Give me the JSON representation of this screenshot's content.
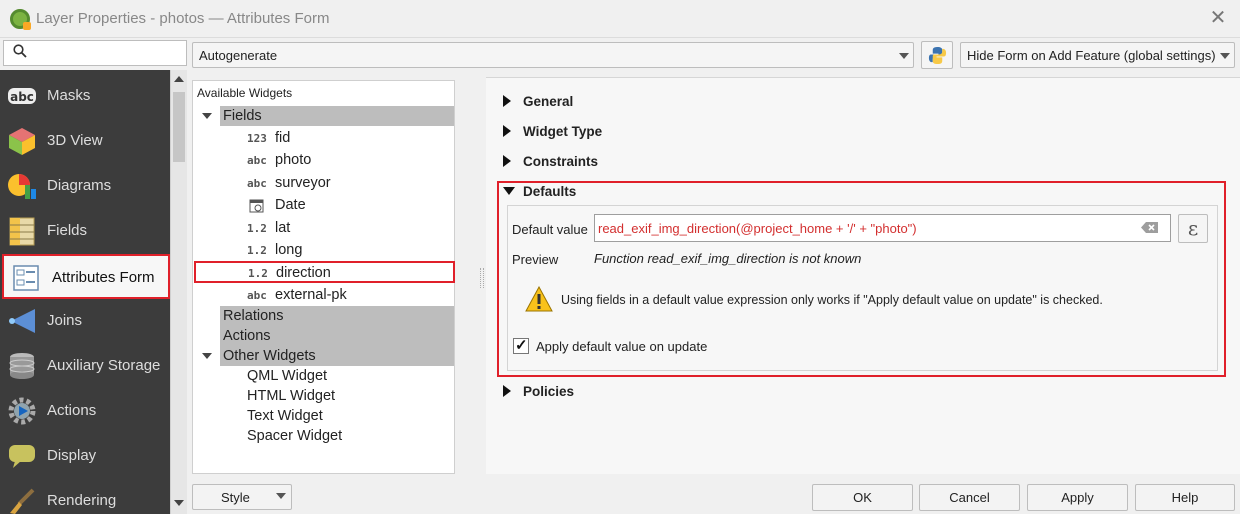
{
  "window": {
    "title": "Layer Properties - photos — Attributes Form"
  },
  "sidebar": {
    "items": [
      {
        "label": "Masks",
        "icon": "masks-icon"
      },
      {
        "label": "3D View",
        "icon": "3d-cube-icon"
      },
      {
        "label": "Diagrams",
        "icon": "diagram-pie-icon"
      },
      {
        "label": "Fields",
        "icon": "fields-table-icon"
      },
      {
        "label": "Attributes Form",
        "icon": "form-icon",
        "active": true
      },
      {
        "label": "Joins",
        "icon": "joins-icon"
      },
      {
        "label": "Auxiliary Storage",
        "icon": "database-icon"
      },
      {
        "label": "Actions",
        "icon": "gear-play-icon"
      },
      {
        "label": "Display",
        "icon": "speech-bubble-icon"
      },
      {
        "label": "Rendering",
        "icon": "paintbrush-icon"
      }
    ]
  },
  "toolbar": {
    "layout_mode": "Autogenerate",
    "hide_form": "Hide Form on Add Feature (global settings)"
  },
  "widgets": {
    "title": "Available Widgets",
    "fields_group": "Fields",
    "fields": [
      {
        "type": "123",
        "name": "fid"
      },
      {
        "type": "abc",
        "name": "photo"
      },
      {
        "type": "abc",
        "name": "surveyor"
      },
      {
        "type": "date",
        "name": "Date"
      },
      {
        "type": "1.2",
        "name": "lat"
      },
      {
        "type": "1.2",
        "name": "long"
      },
      {
        "type": "1.2",
        "name": "direction",
        "selected": true
      },
      {
        "type": "abc",
        "name": "external-pk"
      }
    ],
    "relations_group": "Relations",
    "actions_group": "Actions",
    "other_group": "Other Widgets",
    "other": [
      "QML Widget",
      "HTML Widget",
      "Text Widget",
      "Spacer Widget"
    ]
  },
  "sections": {
    "general": "General",
    "widget_type": "Widget Type",
    "constraints": "Constraints",
    "defaults": "Defaults",
    "policies": "Policies"
  },
  "defaults": {
    "default_value_label": "Default value",
    "default_value": "read_exif_img_direction(@project_home + '/' + \"photo\")",
    "expression_button": "ε",
    "preview_label": "Preview",
    "preview_text": "Function read_exif_img_direction is not known",
    "warning": "Using fields in a default value expression only works if \"Apply default value on update\" is checked.",
    "apply_on_update_label": "Apply default value on update",
    "apply_on_update_checked": true,
    "checkmark": "✓"
  },
  "buttons": {
    "style": "Style",
    "ok": "OK",
    "cancel": "Cancel",
    "apply": "Apply",
    "help": "Help"
  },
  "colors": {
    "highlight_border": "#e0202a",
    "sidebar_bg": "#3c3c3c",
    "expression_text": "#d32f2f"
  }
}
